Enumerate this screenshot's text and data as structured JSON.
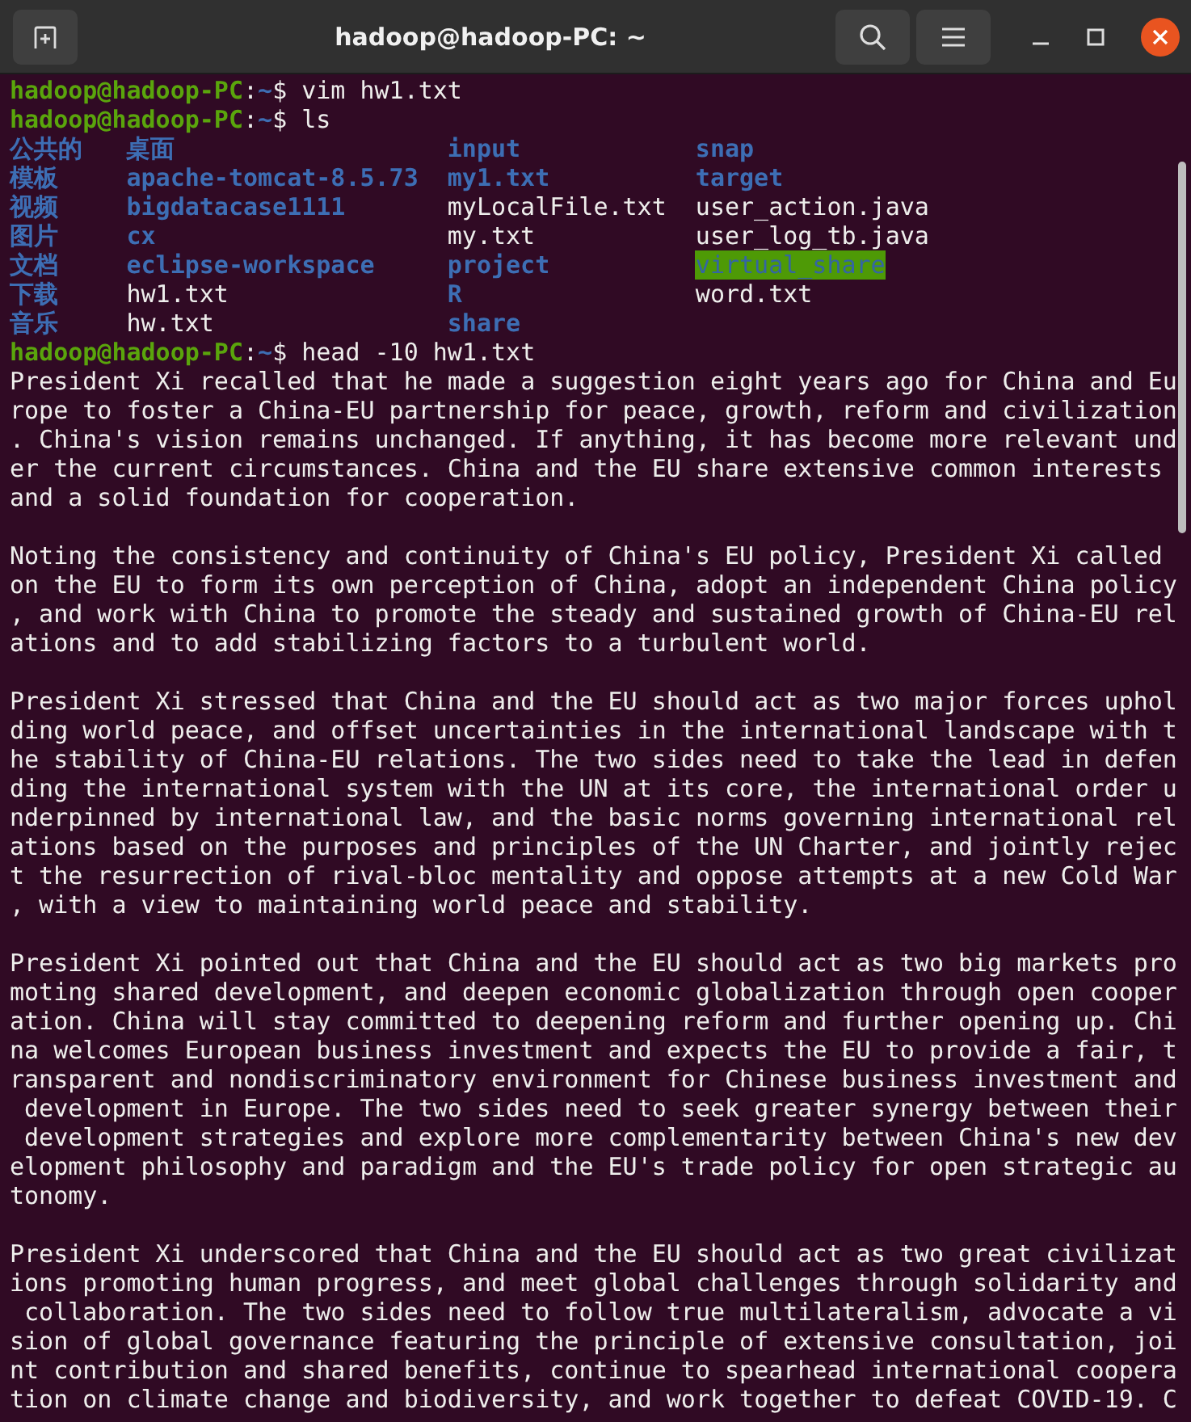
{
  "window": {
    "title": "hadoop@hadoop-PC: ~"
  },
  "terminal": [
    {
      "kind": "prompt",
      "user_host": "hadoop@hadoop-PC",
      "separator": ":",
      "path": "~",
      "command": "$ vim hw1.txt"
    },
    {
      "kind": "prompt",
      "user_host": "hadoop@hadoop-PC",
      "separator": ":",
      "path": "~",
      "command": "$ ls"
    },
    {
      "kind": "listing",
      "rows": [
        [
          {
            "name": "公共的",
            "kind": "directory"
          },
          {
            "name": "桌面",
            "kind": "directory"
          },
          {
            "name": "input",
            "kind": "directory"
          },
          {
            "name": "snap",
            "kind": "directory"
          }
        ],
        [
          {
            "name": "模板",
            "kind": "directory"
          },
          {
            "name": "apache-tomcat-8.5.73",
            "kind": "directory"
          },
          {
            "name": "my1.txt",
            "kind": "directory"
          },
          {
            "name": "target",
            "kind": "directory"
          }
        ],
        [
          {
            "name": "视频",
            "kind": "directory"
          },
          {
            "name": "bigdatacase1111",
            "kind": "directory"
          },
          {
            "name": "myLocalFile.txt",
            "kind": "file"
          },
          {
            "name": "user_action.java",
            "kind": "file"
          }
        ],
        [
          {
            "name": "图片",
            "kind": "directory"
          },
          {
            "name": "cx",
            "kind": "directory"
          },
          {
            "name": "my.txt",
            "kind": "file"
          },
          {
            "name": "user_log_tb.java",
            "kind": "file"
          }
        ],
        [
          {
            "name": "文档",
            "kind": "directory"
          },
          {
            "name": "eclipse-workspace",
            "kind": "directory"
          },
          {
            "name": "project",
            "kind": "directory"
          },
          {
            "name": "virtual_share",
            "kind": "shared_directory"
          }
        ],
        [
          {
            "name": "下载",
            "kind": "directory"
          },
          {
            "name": "hw1.txt",
            "kind": "file"
          },
          {
            "name": "R",
            "kind": "directory"
          },
          {
            "name": "word.txt",
            "kind": "file"
          }
        ],
        [
          {
            "name": "音乐",
            "kind": "directory"
          },
          {
            "name": "hw.txt",
            "kind": "file"
          },
          {
            "name": "share",
            "kind": "directory"
          }
        ]
      ]
    },
    {
      "kind": "prompt",
      "user_host": "hadoop@hadoop-PC",
      "separator": ":",
      "path": "~",
      "command": "$ head -10 hw1.txt"
    },
    {
      "kind": "output",
      "paragraphs": [
        [
          "President Xi recalled that he made a suggestion eight years ago for China and Eu",
          "rope to foster a China-EU partnership for peace, growth, reform and civilization",
          ". China's vision remains unchanged. If anything, it has become more relevant und",
          "er the current circumstances. China and the EU share extensive common interests ",
          "and a solid foundation for cooperation."
        ],
        [
          "Noting the consistency and continuity of China's EU policy, President Xi called ",
          "on the EU to form its own perception of China, adopt an independent China policy",
          ", and work with China to promote the steady and sustained growth of China-EU rel",
          "ations and to add stabilizing factors to a turbulent world."
        ],
        [
          "President Xi stressed that China and the EU should act as two major forces uphol",
          "ding world peace, and offset uncertainties in the international landscape with t",
          "he stability of China-EU relations. The two sides need to take the lead in defen",
          "ding the international system with the UN at its core, the international order u",
          "nderpinned by international law, and the basic norms governing international rel",
          "ations based on the purposes and principles of the UN Charter, and jointly rejec",
          "t the resurrection of rival-bloc mentality and oppose attempts at a new Cold War",
          ", with a view to maintaining world peace and stability."
        ],
        [
          "President Xi pointed out that China and the EU should act as two big markets pro",
          "moting shared development, and deepen economic globalization through open cooper",
          "ation. China will stay committed to deepening reform and further opening up. Chi",
          "na welcomes European business investment and expects the EU to provide a fair, t",
          "ransparent and nondiscriminatory environment for Chinese business investment and",
          " development in Europe. The two sides need to seek greater synergy between their",
          " development strategies and explore more complementarity between China's new dev",
          "elopment philosophy and paradigm and the EU's trade policy for open strategic au",
          "tonomy."
        ],
        [
          "President Xi underscored that China and the EU should act as two great civilizat",
          "ions promoting human progress, and meet global challenges through solidarity and",
          " collaboration. The two sides need to follow true multilateralism, advocate a vi",
          "sion of global governance featuring the principle of extensive consultation, joi",
          "nt contribution and shared benefits, continue to spearhead international coopera",
          "tion on climate change and biodiversity, and work together to defeat COVID-19. C"
        ]
      ]
    }
  ]
}
